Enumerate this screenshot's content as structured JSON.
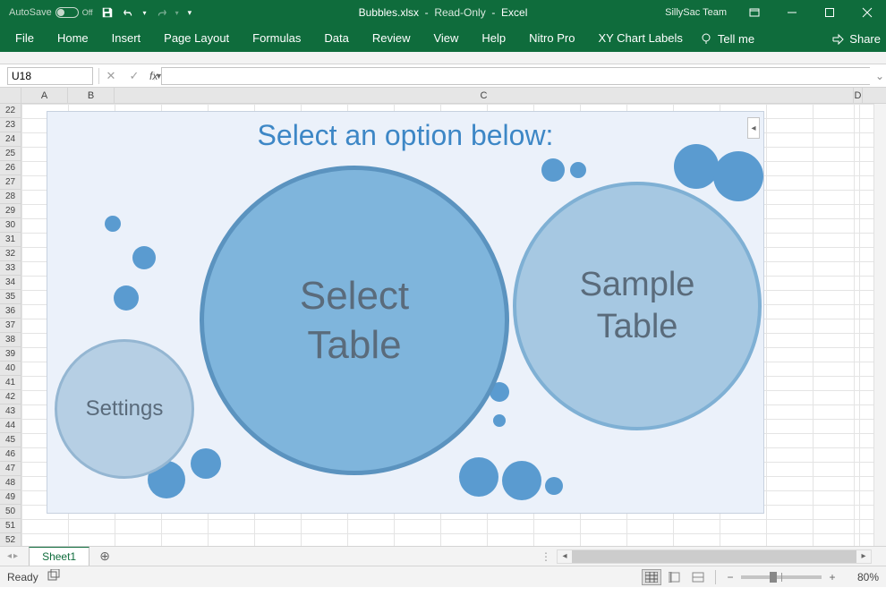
{
  "titlebar": {
    "autosave_label": "AutoSave",
    "autosave_state": "Off",
    "filename": "Bubbles.xlsx",
    "mode": "Read-Only",
    "app": "Excel",
    "user": "SillySac Team"
  },
  "ribbon": {
    "tabs": [
      "File",
      "Home",
      "Insert",
      "Page Layout",
      "Formulas",
      "Data",
      "Review",
      "View",
      "Help",
      "Nitro Pro",
      "XY Chart Labels"
    ],
    "tellme": "Tell me",
    "share": "Share"
  },
  "formula_bar": {
    "namebox": "U18",
    "fx_label": "fx",
    "formula": ""
  },
  "columns": [
    "A",
    "B",
    "C",
    "D"
  ],
  "rows_start": 22,
  "rows_end": 52,
  "chart": {
    "title": "Select an option below:",
    "select_label": "Select Table",
    "sample_label": "Sample Table",
    "settings_label": "Settings"
  },
  "sheets": {
    "active": "Sheet1"
  },
  "statusbar": {
    "state": "Ready",
    "zoom": "80%"
  },
  "chart_data": {
    "type": "bubble",
    "title": "Select an option below:",
    "series": [
      {
        "name": "Select Table",
        "size": 346
      },
      {
        "name": "Sample Table",
        "size": 278
      },
      {
        "name": "Settings",
        "size": 156
      }
    ]
  }
}
